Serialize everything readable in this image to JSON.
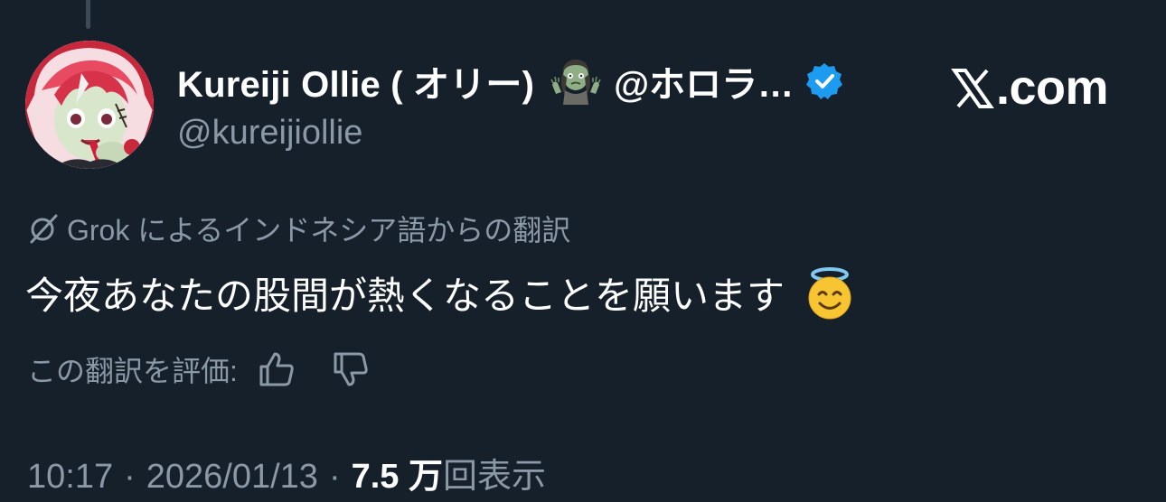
{
  "tweet": {
    "author": {
      "display_name": "Kureiji Ollie ( オリー)",
      "name_emoji": "zombie-emoji",
      "affiliate_handle": "@ホロラ…",
      "verified": true,
      "handle": "@kureijiollie"
    },
    "brand": {
      "text": ".com",
      "logo": "x-logo"
    },
    "translation_note": "Grok によるインドネシア語からの翻訳",
    "translated_text": "今夜あなたの股間が熱くなることを願います",
    "text_emoji": "smiling-face-with-halo-emoji",
    "rate_label": "この翻訳を評価:",
    "rate_icons": [
      "thumbs-up-icon",
      "thumbs-down-icon"
    ],
    "time": "10:17",
    "separator": "·",
    "date": "2026/01/13",
    "views_count": "7.5 万",
    "views_label": "回表示"
  },
  "colors": {
    "background": "#15202b",
    "primary_text": "#ffffff",
    "secondary_text": "#8b98a5",
    "verified_blue": "#1d9bf0"
  }
}
